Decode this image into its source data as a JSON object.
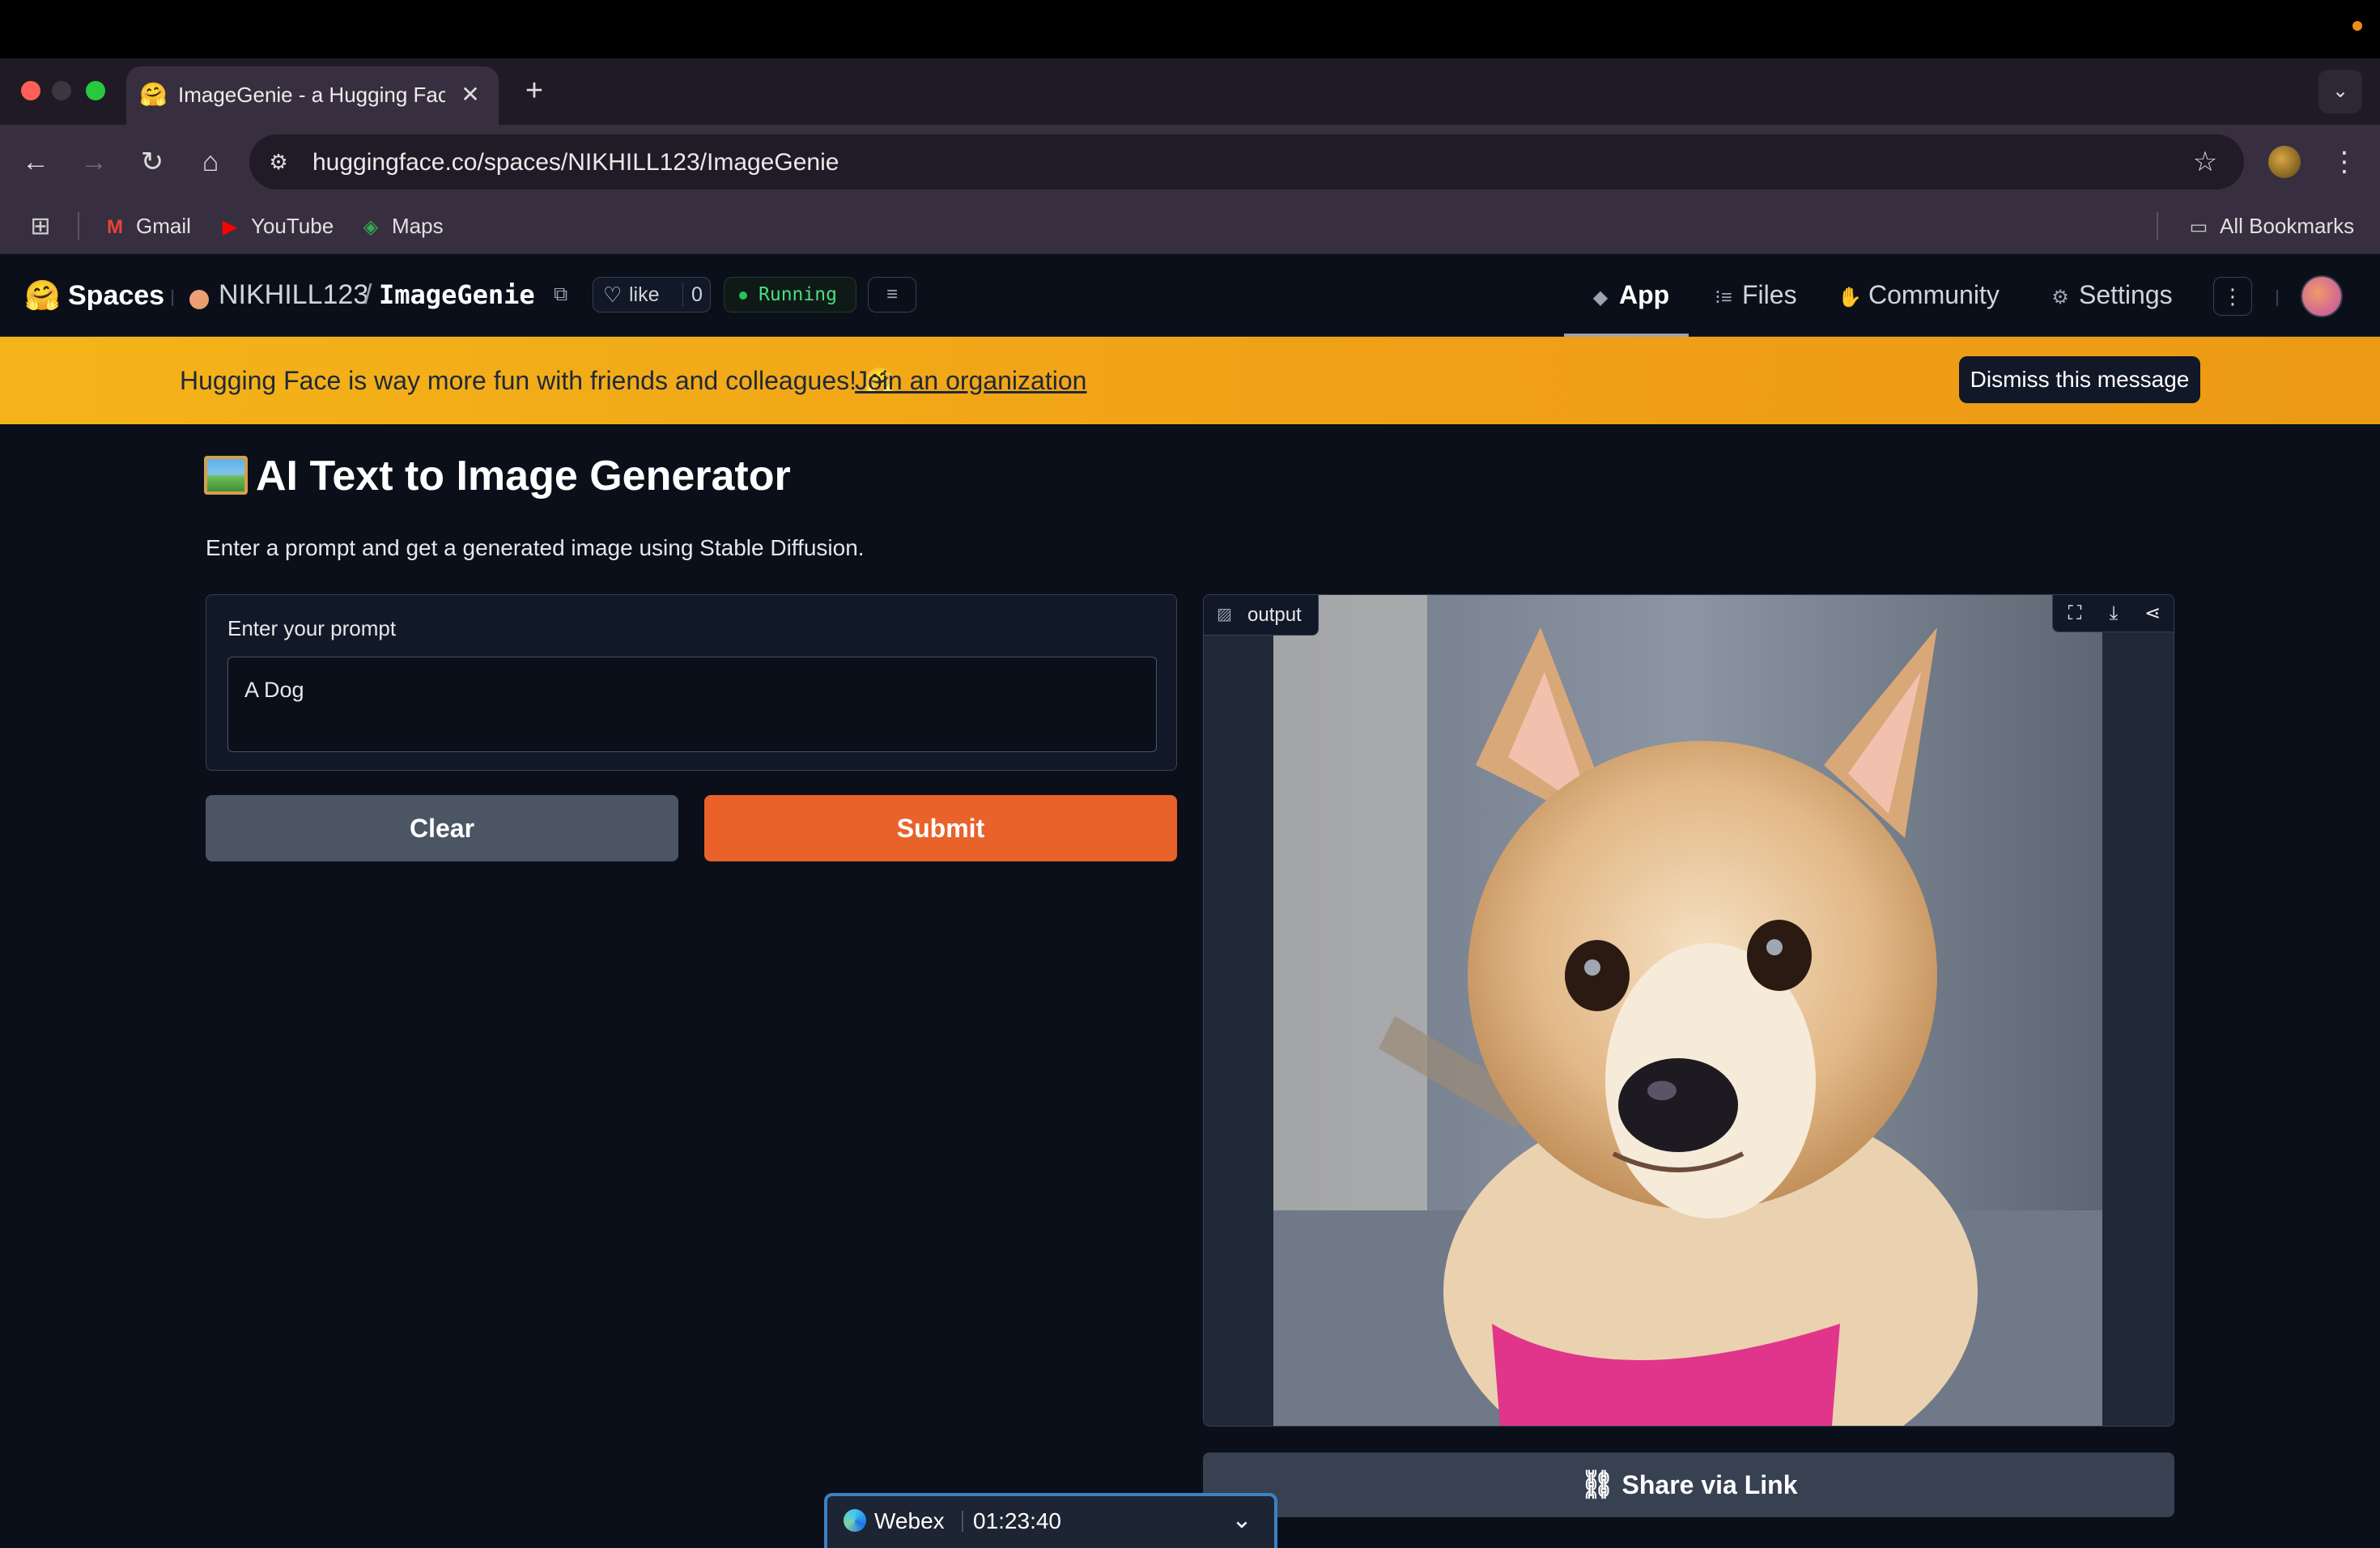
{
  "browser": {
    "tab_title": "ImageGenie - a Hugging Face Space",
    "tab_favicon": "🤗",
    "new_tab_label": "+",
    "close_label": "✕",
    "url": "huggingface.co/spaces/NIKHILL123/ImageGenie",
    "bookmarks": [
      {
        "label": "Gmail",
        "icon": "gmail-icon",
        "glyph": "M"
      },
      {
        "label": "YouTube",
        "icon": "youtube-icon",
        "glyph": "▶"
      },
      {
        "label": "Maps",
        "icon": "maps-icon",
        "glyph": "◈"
      }
    ],
    "all_bookmarks": "All Bookmarks"
  },
  "hf_header": {
    "spaces_label": "Spaces",
    "owner": "NIKHILL123",
    "separator": "/",
    "space_name": "ImageGenie",
    "like_label": "like",
    "like_count": "0",
    "status": "Running",
    "tabs": [
      {
        "label": "App",
        "icon": "cube-icon",
        "active": true
      },
      {
        "label": "Files",
        "icon": "files-icon",
        "active": false
      },
      {
        "label": "Community",
        "icon": "community-icon",
        "active": false
      },
      {
        "label": "Settings",
        "icon": "gear-icon",
        "active": false
      }
    ]
  },
  "banner": {
    "message": "Hugging Face is way more fun with friends and colleagues! 🤗",
    "link": "Join an organization",
    "dismiss": "Dismiss this message"
  },
  "app": {
    "title": "AI Text to Image Generator",
    "description": "Enter a prompt and get a generated image using Stable Diffusion.",
    "prompt_label": "Enter your prompt",
    "prompt_value": "A Dog",
    "clear_label": "Clear",
    "submit_label": "Submit",
    "output_label": "output",
    "share_label": "Share via Link"
  },
  "webex": {
    "name": "Webex",
    "timer": "01:23:40"
  },
  "colors": {
    "accent_submit": "#e8622a",
    "banner": "#f0a016",
    "status_green": "#4ade80",
    "page_bg": "#0b0f19"
  }
}
